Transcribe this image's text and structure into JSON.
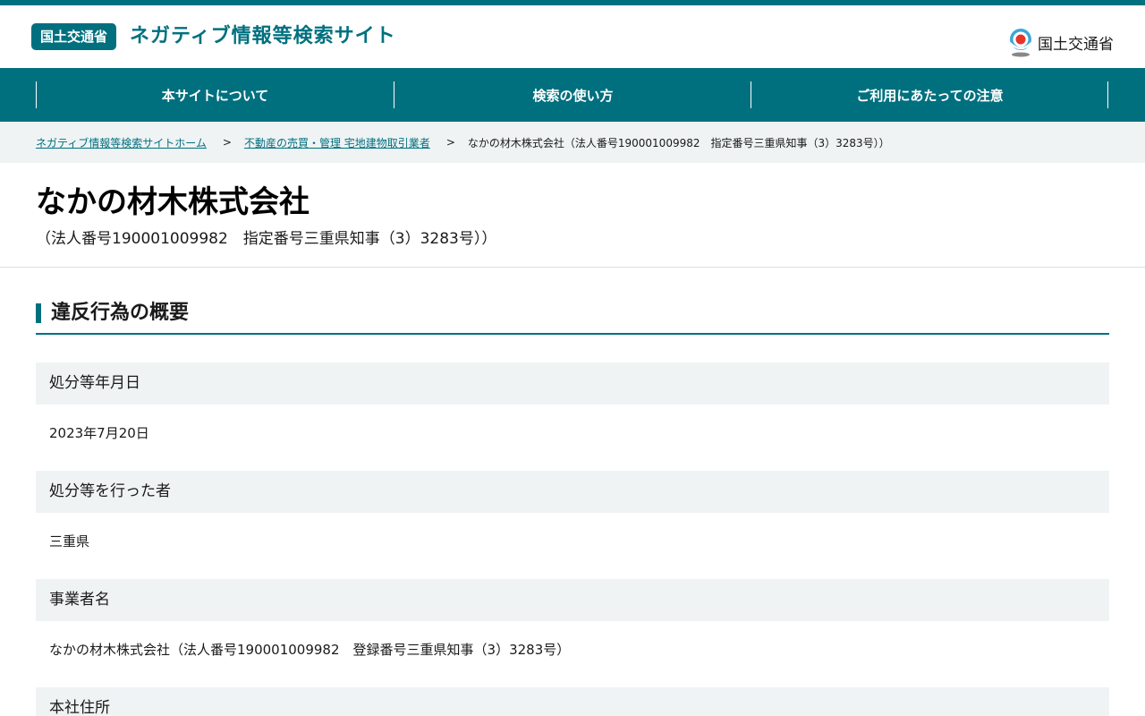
{
  "header": {
    "badge": "国土交通省",
    "site_title": "ネガティブ情報等検索サイト",
    "logo_text": "国土交通省"
  },
  "nav": {
    "items": [
      {
        "label": "本サイトについて"
      },
      {
        "label": "検索の使い方"
      },
      {
        "label": "ご利用にあたっての注意"
      }
    ]
  },
  "breadcrumb": {
    "home": "ネガティブ情報等検索サイトホーム",
    "category": "不動産の売買・管理 宅地建物取引業者",
    "current": "なかの材木株式会社（法人番号190001009982　指定番号三重県知事（3）3283号））",
    "separator": ">"
  },
  "page": {
    "title": "なかの材木株式会社",
    "subtitle": "（法人番号190001009982　指定番号三重県知事（3）3283号））"
  },
  "section": {
    "title": "違反行為の概要",
    "rows": [
      {
        "label": "処分等年月日",
        "value": "2023年7月20日"
      },
      {
        "label": "処分等を行った者",
        "value": "三重県"
      },
      {
        "label": "事業者名",
        "value": "なかの材木株式会社（法人番号190001009982　登録番号三重県知事（3）3283号）"
      },
      {
        "label": "本社住所",
        "value": ""
      }
    ]
  },
  "colors": {
    "brand": "#00707f",
    "band": "#eff3f4"
  }
}
